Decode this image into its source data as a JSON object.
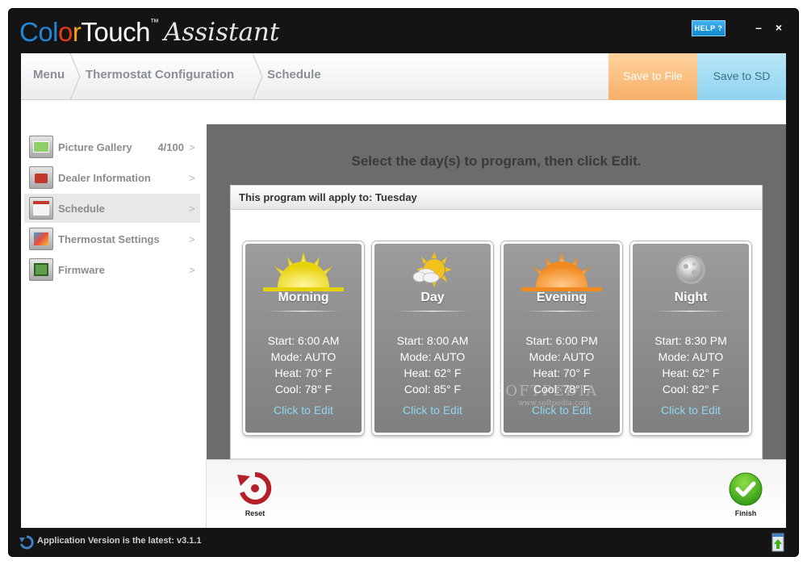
{
  "app": {
    "brand_part1": "Col",
    "brand_part2": "o",
    "brand_part3": "r",
    "brand_part4": "Touch",
    "tm": "™",
    "subtitle": "Assistant",
    "help_label": "HELP ?",
    "minimize_label": "–",
    "close_label": "×"
  },
  "breadcrumb": {
    "items": [
      "Menu",
      "Thermostat Configuration",
      "Schedule"
    ],
    "save_file_label": "Save to File",
    "save_sd_label": "Save to SD"
  },
  "sidebar": {
    "items": [
      {
        "label": "Picture Gallery",
        "count": "4/100",
        "icon": "picture-gallery-icon"
      },
      {
        "label": "Dealer Information",
        "count": "",
        "icon": "dealer-info-icon"
      },
      {
        "label": "Schedule",
        "count": "",
        "icon": "schedule-icon",
        "active": true
      },
      {
        "label": "Thermostat Settings",
        "count": "",
        "icon": "thermostat-settings-icon"
      },
      {
        "label": "Firmware",
        "count": "",
        "icon": "firmware-icon"
      }
    ],
    "arrow": ">"
  },
  "main": {
    "instruction": "Select the day(s) to program, then click Edit.",
    "panel_title": "This program will apply to: Tuesday",
    "cards": [
      {
        "title": "Morning",
        "start": "Start: 6:00 AM",
        "mode": "Mode: AUTO",
        "heat": "Heat: 70° F",
        "cool": "Cool: 78° F",
        "edit": "Click to Edit",
        "icon": "sunrise-icon"
      },
      {
        "title": "Day",
        "start": "Start: 8:00 AM",
        "mode": "Mode: AUTO",
        "heat": "Heat: 62° F",
        "cool": "Cool: 85° F",
        "edit": "Click to Edit",
        "icon": "sun-cloud-icon"
      },
      {
        "title": "Evening",
        "start": "Start: 6:00 PM",
        "mode": "Mode: AUTO",
        "heat": "Heat: 70° F",
        "cool": "Cool: 78° F",
        "edit": "Click to Edit",
        "icon": "sunset-icon"
      },
      {
        "title": "Night",
        "start": "Start: 8:30 PM",
        "mode": "Mode: AUTO",
        "heat": "Heat: 62° F",
        "cool": "Cool: 82° F",
        "edit": "Click to Edit",
        "icon": "moon-icon"
      }
    ]
  },
  "toolbar": {
    "reset_label": "Reset",
    "finish_label": "Finish"
  },
  "status": {
    "text": "Application Version is the latest: v3.1.1"
  },
  "watermark": {
    "text": "SOFTPEDIA",
    "sub": "www.softpedia.com"
  },
  "colors": {
    "save_file": "#f6b06a",
    "save_sd": "#8fd3ef",
    "edit_link": "#8fd6f4",
    "finish_green": "#3fae1a",
    "reset_red": "#b51f2a"
  }
}
